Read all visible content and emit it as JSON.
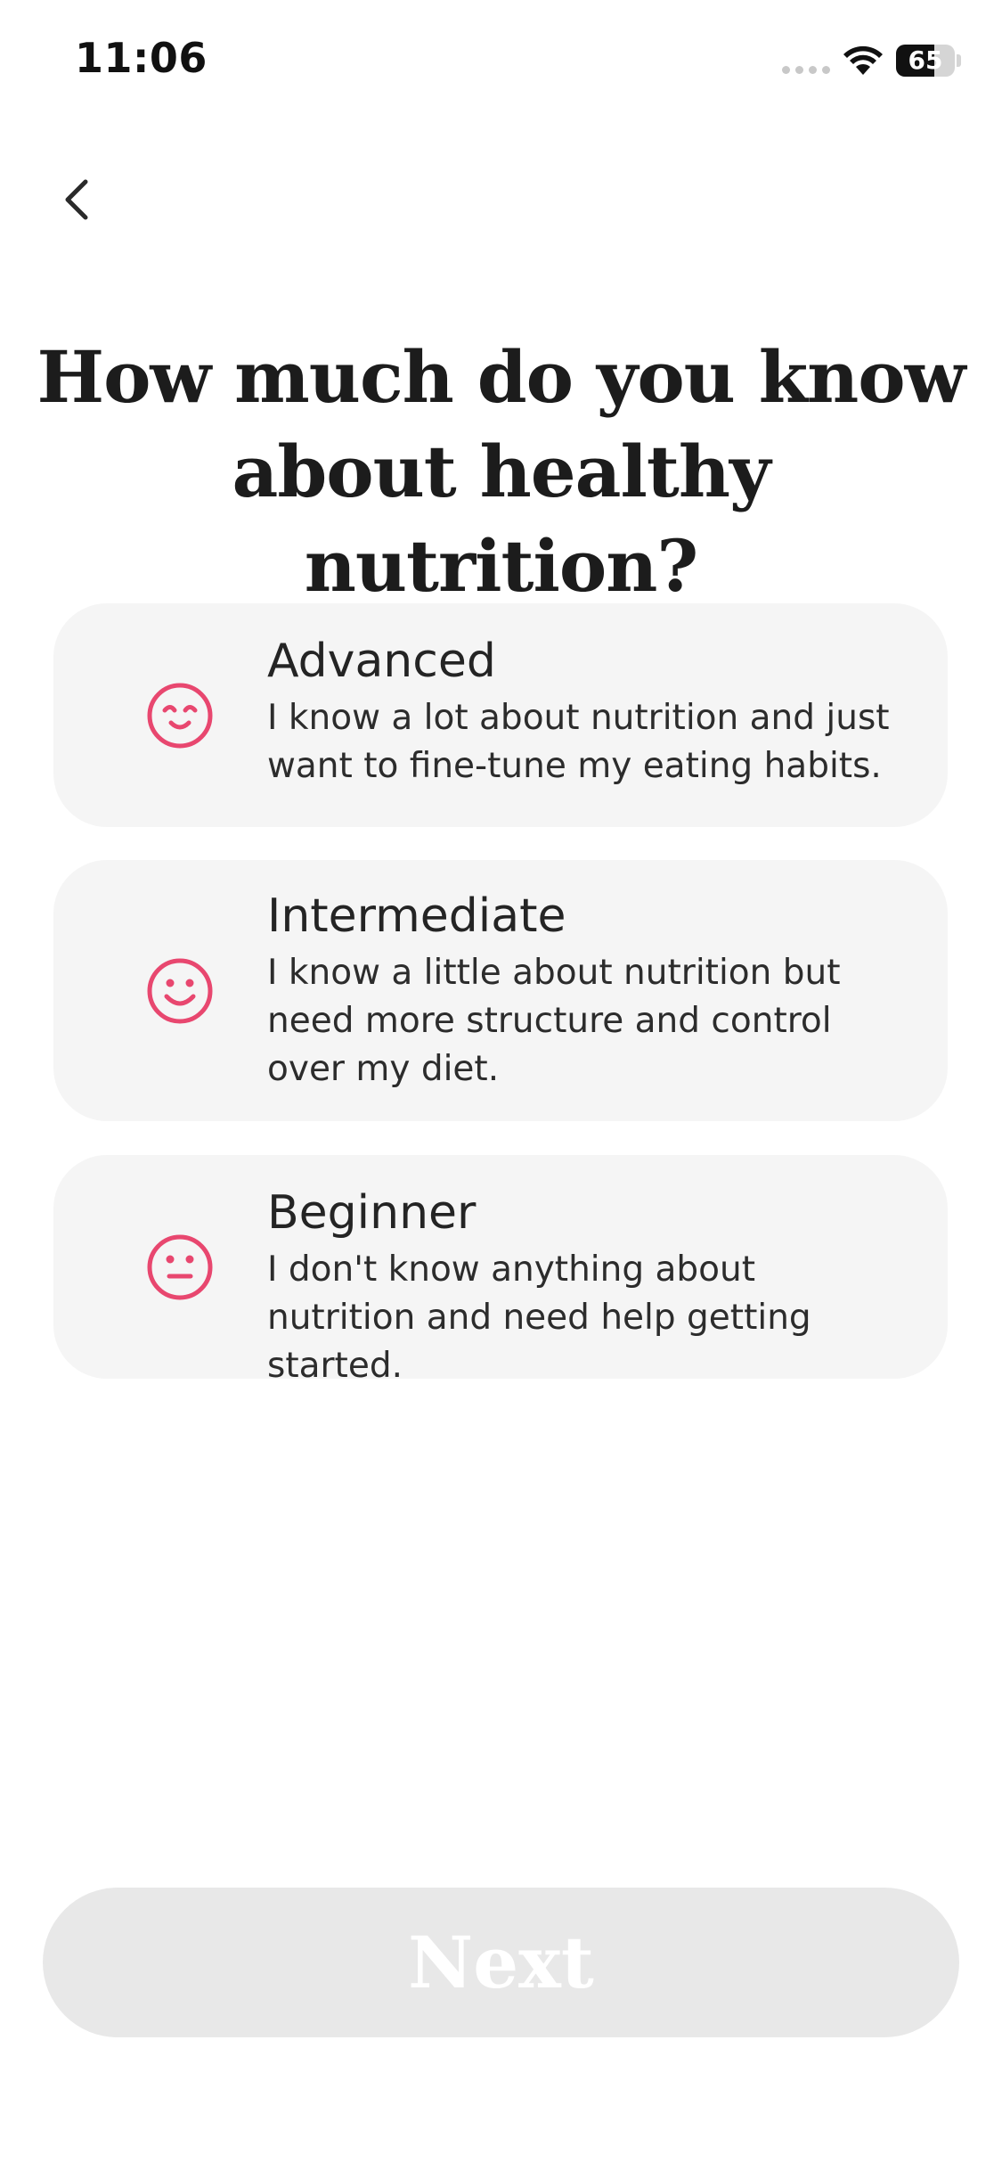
{
  "status_bar": {
    "time": "11:06",
    "battery_percent": "65",
    "battery_level": 0.65,
    "icons": [
      "cellular-signal-icon",
      "wifi-icon",
      "battery-icon"
    ]
  },
  "nav": {
    "back_icon": "chevron-left-icon"
  },
  "title": "How much do you know about healthy nutrition?",
  "options": [
    {
      "label": "Advanced",
      "description": "I know a lot about nutrition and just want to fine-tune my eating habits.",
      "icon": "smiling-face-closed-eyes-icon",
      "selected": false
    },
    {
      "label": "Intermediate",
      "description": "I know a little about nutrition but need more structure and control over my diet.",
      "icon": "smiling-face-icon",
      "selected": false
    },
    {
      "label": "Beginner",
      "description": "I don't know anything about nutrition and need help getting started.",
      "icon": "neutral-face-icon",
      "selected": false
    }
  ],
  "next_button": {
    "label": "Next",
    "enabled": false
  },
  "colors": {
    "accent": "#e8476f",
    "card_background": "#f5f5f5",
    "button_disabled": "#e8e8e8",
    "text": "#1f1f1f"
  }
}
